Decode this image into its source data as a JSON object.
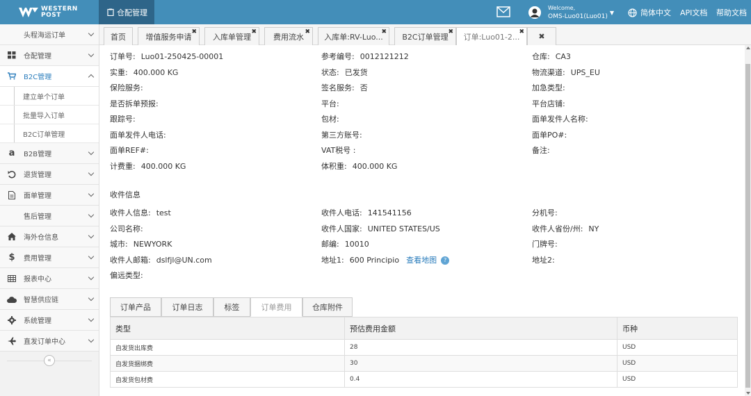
{
  "header": {
    "logo_line1": "WESTERN",
    "logo_line2": "POST",
    "module": "仓配管理",
    "welcome": "Welcome,",
    "username": "OMS-Luo01(Luo01)",
    "language": "简体中文",
    "api_docs": "API文档",
    "help_docs": "帮助文档"
  },
  "sidebar": {
    "items": [
      {
        "label": "头程海运订单"
      },
      {
        "label": "仓配管理",
        "icon": "grid-icon"
      },
      {
        "label": "B2C管理",
        "icon": "cart-icon"
      },
      {
        "label": "B2B管理",
        "icon": "amazon-icon"
      },
      {
        "label": "退货管理",
        "icon": "undo-icon"
      },
      {
        "label": "面单管理",
        "icon": "file-icon"
      },
      {
        "label": "售后管理"
      },
      {
        "label": "海外仓信息",
        "icon": "home-icon"
      },
      {
        "label": "费用管理",
        "icon": "dollar-icon"
      },
      {
        "label": "报表中心",
        "icon": "table-icon"
      },
      {
        "label": "智慧供应链",
        "icon": "cloud-icon"
      },
      {
        "label": "系统管理",
        "icon": "gear-icon"
      },
      {
        "label": "直发订单中心",
        "icon": "plane-icon"
      }
    ],
    "sub_items": [
      {
        "label": "建立单个订单"
      },
      {
        "label": "批量导入订单"
      },
      {
        "label": "B2C订单管理"
      }
    ]
  },
  "tabs": [
    {
      "label": "首页"
    },
    {
      "label": "增值服务申请"
    },
    {
      "label": "入库单管理"
    },
    {
      "label": "费用流水"
    },
    {
      "label": "入库单:RV-Luo..."
    },
    {
      "label": "B2C订单管理"
    },
    {
      "label": "订单:Luo01-2..."
    }
  ],
  "order": {
    "order_no_label": "订单号:",
    "order_no": "Luo01-250425-00001",
    "ref_label": "参考编号:",
    "ref": "0012121212",
    "warehouse_label": "仓库:",
    "warehouse": "CA3",
    "weight_label": "实重:",
    "weight": "400.000 KG",
    "status_label": "状态:",
    "status": "已发货",
    "channel_label": "物流渠道:",
    "channel": "UPS_EU",
    "insurance_label": "保险服务:",
    "signature_label": "签名服务:",
    "signature": "否",
    "urgent_label": "加急类型:",
    "split_label": "是否拆单预报:",
    "platform_label": "平台:",
    "shop_label": "平台店铺:",
    "tracking_label": "跟踪号:",
    "packing_label": "包材:",
    "sender_name_label": "面单发件人名称:",
    "sender_phone_label": "面单发件人电话:",
    "third_party_label": "第三方账号:",
    "po_label": "面单PO#:",
    "ref2_label": "面单REF#:",
    "vat_label": "VAT税号 :",
    "remark_label": "备注:",
    "charge_weight_label": "计费重:",
    "charge_weight": "400.000 KG",
    "volume_weight_label": "体积重:",
    "volume_weight": "400.000 KG"
  },
  "recipient": {
    "section_title": "收件信息",
    "name_label": "收件人信息:",
    "name": "test",
    "phone_label": "收件人电话:",
    "phone": "141541156",
    "ext_label": "分机号:",
    "company_label": "公司名称:",
    "country_label": "收件人国家:",
    "country": "UNITED STATES/US",
    "state_label": "收件人省份/州:",
    "state": "NY",
    "city_label": "城市:",
    "city": "NEWYORK",
    "zip_label": "邮编:",
    "zip": "10010",
    "door_label": "门牌号:",
    "email_label": "收件人邮箱:",
    "email": "dslfjl@UN.com",
    "addr1_label": "地址1:",
    "addr1": "600 Principio",
    "map_link": "查看地图",
    "addr2_label": "地址2:",
    "remote_label": "偏远类型:"
  },
  "subtabs": [
    {
      "label": "订单产品"
    },
    {
      "label": "订单日志"
    },
    {
      "label": "标签"
    },
    {
      "label": "订单费用"
    },
    {
      "label": "仓库附件"
    }
  ],
  "fee_table": {
    "headers": [
      "类型",
      "预估费用金额",
      "币种"
    ],
    "rows": [
      [
        "自发货出库费",
        "28",
        "USD"
      ],
      [
        "自发货捆绑费",
        "30",
        "USD"
      ],
      [
        "自发货包材费",
        "0.4",
        "USD"
      ]
    ]
  },
  "colors": {
    "topbar": "#438eb9",
    "accent": "#2b7dbc",
    "module_tab": "#2e6589"
  }
}
